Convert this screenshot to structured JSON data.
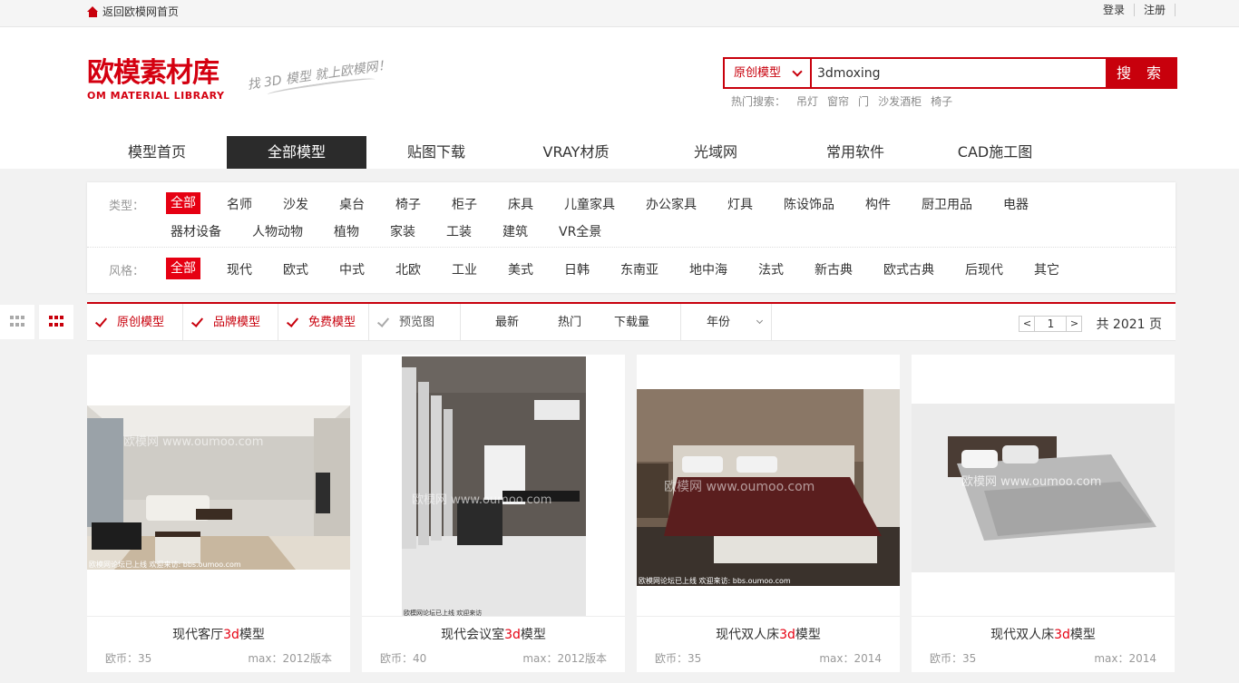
{
  "topbar": {
    "home_link": "返回欧模网首页",
    "login": "登录",
    "register": "注册"
  },
  "logo": {
    "cn": "欧模素材库",
    "en": "OM MATERIAL LIBRARY",
    "slogan": "找 3D 模型 就上欧模网！"
  },
  "search": {
    "category": "原创模型",
    "query": "3dmoxing",
    "button": "搜 索"
  },
  "hot": {
    "label": "热门搜索：",
    "items": [
      "吊灯",
      "窗帘",
      "门",
      "沙发酒柜",
      "椅子"
    ]
  },
  "nav": [
    "模型首页",
    "全部模型",
    "贴图下载",
    "VRAY材质",
    "光域网",
    "常用软件",
    "CAD施工图"
  ],
  "filters": {
    "type_label": "类型：",
    "types": [
      "全部",
      "名师",
      "沙发",
      "桌台",
      "椅子",
      "柜子",
      "床具",
      "儿童家具",
      "办公家具",
      "灯具",
      "陈设饰品",
      "构件",
      "厨卫用品",
      "电器",
      "器材设备",
      "人物动物",
      "植物",
      "家装",
      "工装",
      "建筑",
      "VR全景"
    ],
    "style_label": "风格：",
    "styles": [
      "全部",
      "现代",
      "欧式",
      "中式",
      "北欧",
      "工业",
      "美式",
      "日韩",
      "东南亚",
      "地中海",
      "法式",
      "新古典",
      "欧式古典",
      "后现代",
      "其它"
    ]
  },
  "sortbar": {
    "checks": [
      "原创模型",
      "品牌模型",
      "免费模型",
      "预览图"
    ],
    "sorts": [
      "最新",
      "热门",
      "下载量"
    ],
    "year": "年份",
    "prev": "<",
    "page": "1",
    "next": ">",
    "total": "共 2021 页"
  },
  "cards": [
    {
      "name_pre": "现代客厅",
      "name_hl": "3d",
      "name_post": "模型",
      "price": "欧币：35",
      "version": "max：2012版本",
      "watermark": "欧模网 www.oumoo.com",
      "footer": "欧模网论坛已上线 欢迎来访: bbs.oumoo.com"
    },
    {
      "name_pre": "现代会议室",
      "name_hl": "3d",
      "name_post": "模型",
      "price": "欧币：40",
      "version": "max：2012版本",
      "watermark": "欧模网 www.oumoo.com",
      "footer": "欧模网论坛已上线 欢迎来访"
    },
    {
      "name_pre": "现代双人床",
      "name_hl": "3d",
      "name_post": "模型",
      "price": "欧币：35",
      "version": "max：2014",
      "watermark": "欧模网 www.oumoo.com",
      "footer": "欧模网论坛已上线 欢迎来访: bbs.oumoo.com"
    },
    {
      "name_pre": "现代双人床",
      "name_hl": "3d",
      "name_post": "模型",
      "price": "欧币：35",
      "version": "max：2014",
      "watermark": "欧模网 www.oumoo.com",
      "footer": ""
    }
  ]
}
